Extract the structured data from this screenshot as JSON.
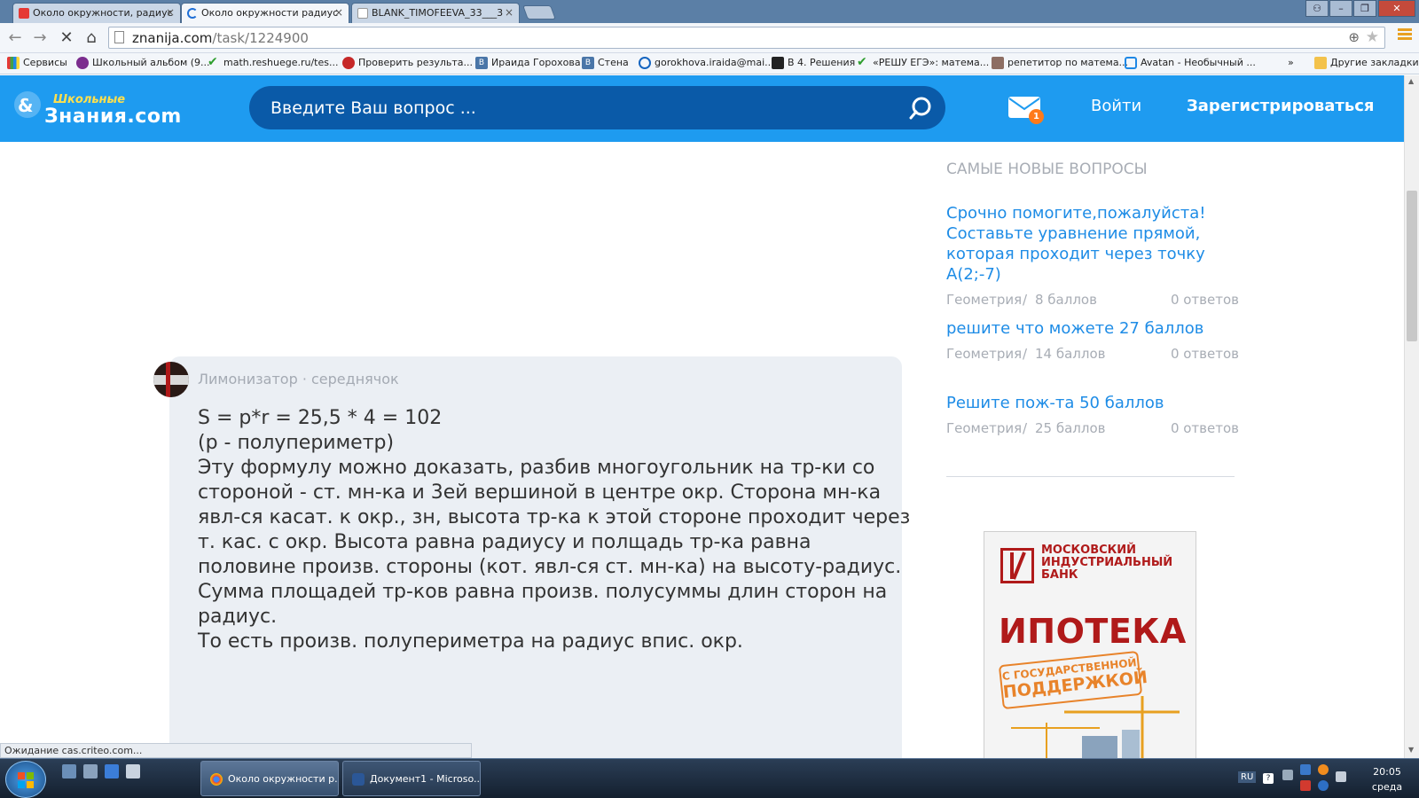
{
  "browser": {
    "tabs": [
      {
        "title": "Около окружности, радиус",
        "active": false
      },
      {
        "title": "Около окружности радиус",
        "active": true
      },
      {
        "title": "BLANK_TIMOFEEVA_33___3",
        "active": false
      }
    ],
    "url_domain": "znanija.com",
    "url_path": "/task/1224900",
    "bookmarks": [
      "Сервисы",
      "Школьный альбом (9...",
      "math.reshuege.ru/tes...",
      "Проверить результа...",
      "Ираида Горохова",
      "Стена",
      "gorokhova.iraida@mai...",
      "В 4. Решения",
      "«РЕШУ ЕГЭ»: матема...",
      "репетитор по матема...",
      "Avatan - Необычный ...",
      "»",
      "Другие закладки"
    ],
    "status": "Ожидание cas.criteo.com..."
  },
  "site": {
    "logo_small": "Школьные",
    "logo_big": "Знания.com",
    "search_placeholder": "Введите Ваш вопрос ...",
    "mail_badge": "1",
    "login": "Войти",
    "register": "Зарегистрироваться"
  },
  "answer": {
    "author": "Лимонизатор · середнячок",
    "lines": [
      "S = p*r = 25,5 * 4 = 102",
      "(p - полупериметр)",
      "Эту формулу можно доказать, разбив многоугольник на тр-ки со",
      "стороной - ст. мн-ка и 3ей вершиной в центре окр. Сторона мн-ка",
      "явл-ся касат. к окр., зн, высота тр-ка к этой стороне проходит через",
      "т. кас. с окр. Высота равна радиусу и полщадь тр-ка равна",
      "половине произв. стороны (кот. явл-ся ст. мн-ка) на высоту-радиус.",
      "Сумма площадей тр-ков равна произв. полусуммы длин сторон на",
      "радиус.",
      "То есть произв. полупериметра на радиус впис. окр."
    ]
  },
  "sidebar": {
    "title": "САМЫЕ НОВЫЕ ВОПРОСЫ",
    "questions": [
      {
        "title_lines": [
          "Срочно помогите,пожалуйста!",
          "Составьте уравнение прямой,",
          "которая проходит через точку А(2;-7)"
        ],
        "subject": "Геометрия",
        "sep": "/",
        "points": "8 баллов",
        "answers": "0 ответов"
      },
      {
        "title_lines": [
          "решите что можете 27 баллов"
        ],
        "subject": "Геометрия",
        "sep": "/",
        "points": "14 баллов",
        "answers": "0 ответов"
      },
      {
        "title_lines": [
          "Решите пож-та 50 баллов"
        ],
        "subject": "Геометрия",
        "sep": "/",
        "points": "25 баллов",
        "answers": "0 ответов"
      }
    ]
  },
  "ad": {
    "bank_line1": "МОСКОВСКИЙ",
    "bank_line2": "ИНДУСТРИАЛЬНЫЙ",
    "bank_line3": "БАНК",
    "headline": "ИПОТЕКА",
    "badge_line1": "С ГОСУДАРСТВЕННОЙ",
    "badge_line2": "ПОДДЕРЖКОЙ"
  },
  "taskbar": {
    "tasks": [
      {
        "label": "Около окружности р...",
        "active": true
      },
      {
        "label": "Документ1 - Microso...",
        "active": false
      }
    ],
    "lang": "RU",
    "time": "20:05",
    "day": "среда"
  },
  "colors": {
    "brand_blue": "#1e9bf0",
    "search_bg": "#0a5aa8",
    "link_blue": "#1e8ce6",
    "badge_orange": "#ff7a1a",
    "ad_red": "#b01a1a"
  }
}
